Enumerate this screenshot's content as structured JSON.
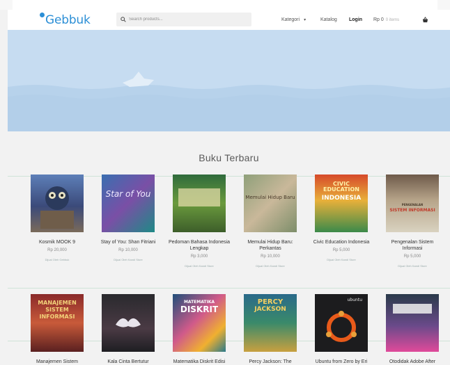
{
  "header": {
    "logo_text": "Gebbuk",
    "search_placeholder": "Search products...",
    "nav": {
      "kategori": "Kategori",
      "katalog": "Katalog",
      "login": "Login",
      "cart_amount": "Rp 0",
      "cart_items": "0 items"
    }
  },
  "section_title": "Buku Terbaru",
  "books_row1": [
    {
      "title": "Kosmik MOOK 9",
      "price": "Rp 20,000",
      "seller": "Dijual Oleh Gebbuk"
    },
    {
      "title": "Stay of You: Shan Fitriani",
      "price": "Rp 10,000",
      "seller": "Dijual Oleh Kandi Store"
    },
    {
      "title": "Pedoman Bahasa Indonesia Lengkap",
      "price": "Rp 3,000",
      "seller": "Dijual Oleh Kandi Store"
    },
    {
      "title": "Memulai Hidup Baru: Perkantas",
      "price": "Rp 10,000",
      "seller": "Dijual Oleh Kandi Store"
    },
    {
      "title": "Civic Education Indonesia",
      "price": "Rp 5,000",
      "seller": "Dijual Oleh Kandi Store"
    },
    {
      "title": "Pengenalan Sistem Informasi",
      "price": "Rp 5,000",
      "seller": "Dijual Oleh Kandi Store"
    }
  ],
  "books_row2": [
    {
      "title": "Manajemen Sistem"
    },
    {
      "title": "Kala Cinta Bertutur"
    },
    {
      "title": "Matematika Diskrit Edisi"
    },
    {
      "title": "Percy Jackson: The"
    },
    {
      "title": "Ubuntu from Zero by Eri"
    },
    {
      "title": "Otodidak Adobe After"
    }
  ],
  "cover_text": {
    "stay": "Star of You",
    "civic": "CIVIC EDUCATION",
    "civic_sub": "INDONESIA",
    "psi": "SISTEM INFORMASI",
    "psi_top": "PENGENALAN",
    "manajemen": "MANAJEMEN SISTEM INFORMASI",
    "diskrit_top": "MATEMATIKA",
    "diskrit": "DISKRIT",
    "percy_top": "PERCY",
    "percy": "JACKSON",
    "ubuntu": "ubuntu",
    "memulai": "Memulai Hidup Baru"
  },
  "colors": {
    "accent": "#2c8fd6",
    "hero": "#c6dcf1",
    "water": "#b8d4ec"
  }
}
